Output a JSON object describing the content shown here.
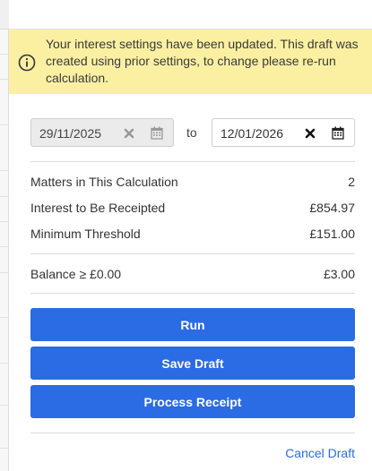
{
  "banner": {
    "message": "Your interest settings have been updated. This draft was created using prior settings, to change please re-run calculation.",
    "icon": "info-circle-icon"
  },
  "dates": {
    "from_value": "29/11/2025",
    "to_label": "to",
    "to_value": "12/01/2026"
  },
  "summary": {
    "matters_label": "Matters in This Calculation",
    "matters_value": "2",
    "interest_label": "Interest to Be Receipted",
    "interest_value": "£854.97",
    "threshold_label": "Minimum Threshold",
    "threshold_value": "£151.00",
    "balance_label": "Balance ≥ £0.00",
    "balance_value": "£3.00"
  },
  "actions": {
    "run_label": "Run",
    "save_draft_label": "Save Draft",
    "process_receipt_label": "Process Receipt",
    "cancel_draft_label": "Cancel Draft"
  },
  "colors": {
    "banner_bg": "#fbf0a2",
    "primary_button": "#2b6be3",
    "link": "#2b6be3"
  }
}
